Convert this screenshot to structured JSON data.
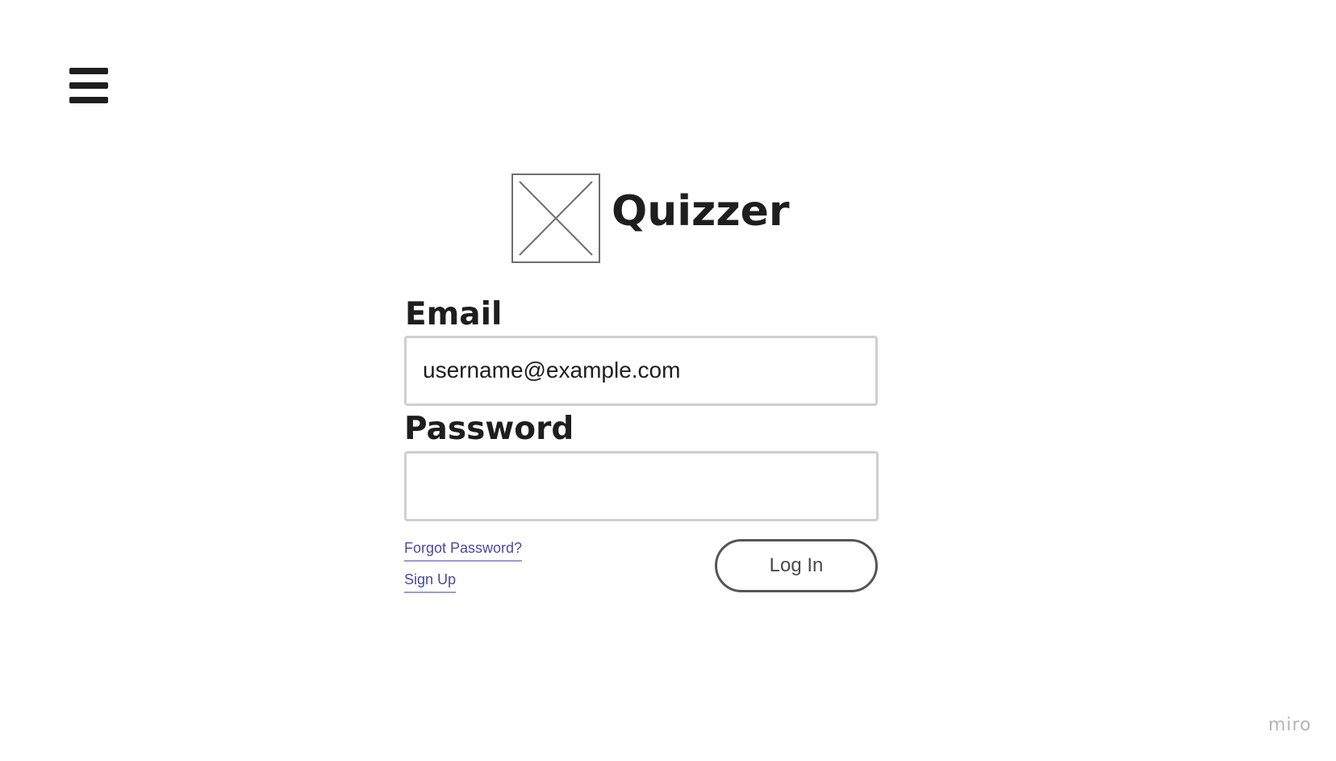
{
  "header": {
    "menu_icon": "hamburger-menu-icon"
  },
  "brand": {
    "logo_icon": "image-placeholder-icon",
    "title": "Quizzer"
  },
  "login_form": {
    "email": {
      "label": "Email",
      "value": "username@example.com"
    },
    "password": {
      "label": "Password",
      "value": ""
    },
    "forgot_password_link": "Forgot Password?",
    "sign_up_link": "Sign Up",
    "login_button": "Log In"
  },
  "watermark": {
    "text": "miro"
  },
  "colors": {
    "text": "#1e1e1e",
    "link": "#4a4aa0",
    "link_underline": "#9a9ad6",
    "input_border": "#cfcfcf",
    "button_border": "#555555",
    "watermark": "#b4b4b4"
  }
}
